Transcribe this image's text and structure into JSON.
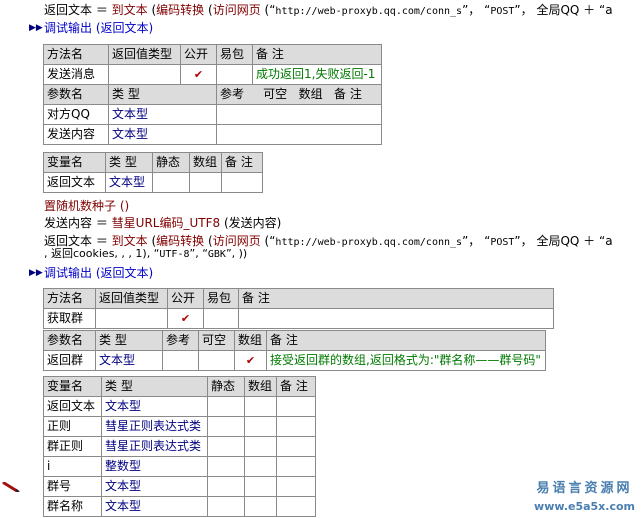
{
  "code": {
    "line1": {
      "var": "返回文本",
      "eq": " ＝ ",
      "fn1": "到文本",
      "p1": " (",
      "fn2": "编码转换",
      "p2": " (",
      "fn3": "访问网页",
      "p3": " (“",
      "url": "http://web-proxyb.qq.com/conn_s",
      "sep1": "”， “",
      "method": "POST",
      "sep2": "”， 全局QQ ＋ “",
      "tail": "a"
    },
    "section1": "调试输出 (返回文本)",
    "line_seed": "置随机数种子 ()",
    "line_send": {
      "var": "发送内容",
      "eq": " ＝ ",
      "fn": "彗星URL编码_UTF8",
      "arg": " (发送内容)"
    },
    "line2": {
      "var": "返回文本",
      "eq": " ＝ ",
      "fn1": "到文本",
      "p1": " (",
      "fn2": "编码转换",
      "p2": " (",
      "fn3": "访问网页",
      "p3": " (“",
      "url": "http://web-proxyb.qq.com/conn_s",
      "sep1": "”， “",
      "method": "POST",
      "sep2": "”， 全局QQ ＋ “",
      "tail": "a"
    },
    "line2b": {
      "start": ", 返回cookies, , , 1), “",
      "enc1": "UTF-8",
      "mid": "”, “",
      "enc2": "GBK",
      "end": "”, ))"
    },
    "section2": "调试输出 (返回文本)"
  },
  "sub1": {
    "method_headers": [
      "方法名",
      "返回值类型",
      "公开",
      "易包",
      "备 注"
    ],
    "method_row": {
      "name": "发送消息",
      "ret": "",
      "public": "✔",
      "pkg": "",
      "note": "成功返回1,失败返回-1"
    },
    "param_headers": [
      "参数名",
      "类 型",
      "参考",
      "可空",
      "数组",
      "备 注"
    ],
    "params": [
      {
        "name": "对方QQ",
        "type": "文本型"
      },
      {
        "name": "发送内容",
        "type": "文本型"
      }
    ],
    "var_headers": [
      "变量名",
      "类 型",
      "静态",
      "数组",
      "备 注"
    ],
    "vars": [
      {
        "name": "返回文本",
        "type": "文本型"
      }
    ]
  },
  "sub2": {
    "method_headers": [
      "方法名",
      "返回值类型",
      "公开",
      "易包",
      "备 注"
    ],
    "method_row": {
      "name": "获取群",
      "ret": "",
      "public": "✔",
      "pkg": "",
      "note": ""
    },
    "param_headers": [
      "参数名",
      "类 型",
      "参考",
      "可空",
      "数组",
      "备 注"
    ],
    "param": {
      "name": "返回群",
      "type": "文本型",
      "array": "✔",
      "note": "接受返回群的数组,返回格式为:\"群名称——群号码\""
    },
    "var_headers": [
      "变量名",
      "类 型",
      "静态",
      "数组",
      "备 注"
    ],
    "vars": [
      {
        "name": "返回文本",
        "type": "文本型"
      },
      {
        "name": "正则",
        "type": "彗星正则表达式类"
      },
      {
        "name": "群正则",
        "type": "彗星正则表达式类"
      },
      {
        "name": "i",
        "type": "整数型"
      },
      {
        "name": "群号",
        "type": "文本型"
      },
      {
        "name": "群名称",
        "type": "文本型"
      }
    ]
  },
  "watermark": {
    "line1": "易语言资源网",
    "line2": "www.e5a5x.com"
  },
  "colors": {
    "keyword": "#0000c8",
    "func": "#800000",
    "comment": "#007a00",
    "header_bg": "#dcdcdc",
    "watermark": "#4a7fb0"
  }
}
